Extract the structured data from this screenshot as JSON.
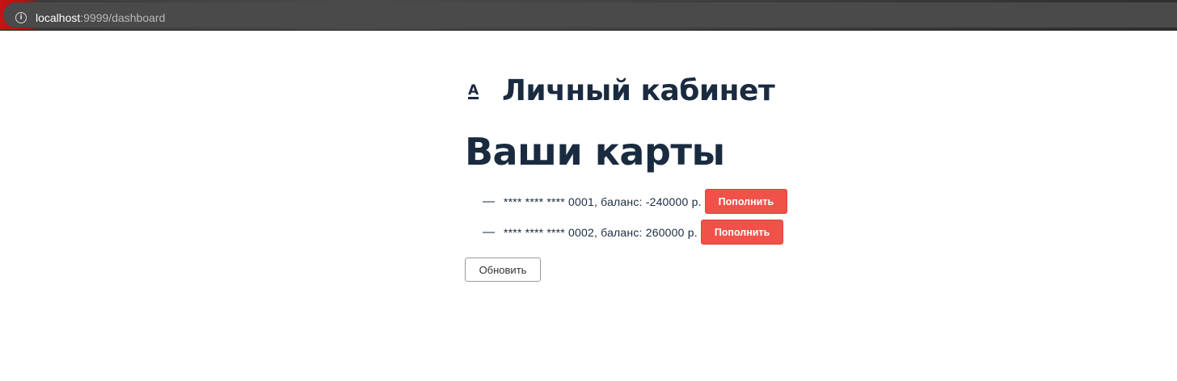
{
  "browser": {
    "url_host": "localhost",
    "url_rest": ":9999/dashboard",
    "info_icon": "info-icon"
  },
  "header": {
    "logo": "A",
    "title": "Личный кабинет"
  },
  "cards_section": {
    "title": "Ваши карты",
    "cards": [
      {
        "dash": "—",
        "text": "**** **** **** 0001, баланс: -240000 р.",
        "button_label": "Пополнить"
      },
      {
        "dash": "—",
        "text": "**** **** **** 0002, баланс: 260000 р.",
        "button_label": "Пополнить"
      }
    ]
  },
  "actions": {
    "refresh_label": "Обновить"
  },
  "colors": {
    "heading": "#1a2b40",
    "topup_button": "#f0524a",
    "browser_bar": "#4a4a4a"
  }
}
